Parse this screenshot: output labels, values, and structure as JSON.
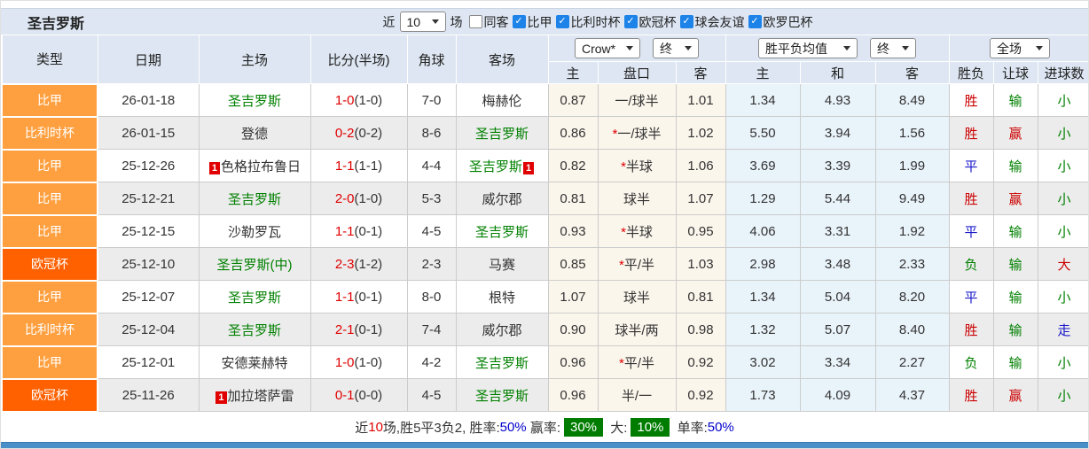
{
  "topbar": {
    "team_title": "圣吉罗斯",
    "near_label": "近",
    "matches_count": "10",
    "field_label": "场",
    "filters": [
      {
        "label": "同客",
        "checked": false
      },
      {
        "label": "比甲",
        "checked": true
      },
      {
        "label": "比利时杯",
        "checked": true
      },
      {
        "label": "欧冠杯",
        "checked": true
      },
      {
        "label": "球会友谊",
        "checked": true
      },
      {
        "label": "欧罗巴杯",
        "checked": true
      }
    ]
  },
  "table": {
    "columns": [
      "类型",
      "日期",
      "主场",
      "比分(半场)",
      "角球",
      "客场"
    ],
    "sub_columns": [
      "主",
      "盘口",
      "客",
      "主",
      "和",
      "客",
      "胜负",
      "让球",
      "进球数"
    ],
    "selects": {
      "bookmaker": "Crow*",
      "bookmaker_state": "终",
      "avg": "胜平负均值",
      "avg_state": "终",
      "scope": "全场"
    }
  },
  "colors": {
    "league_orange": "#ffa040",
    "league_red": "#ff6000",
    "red": "#cc0000",
    "blue": "#1717c9",
    "green": "#008000"
  },
  "result_color_map": {
    "胜": "red",
    "平": "blue",
    "负": "green",
    "赢": "red",
    "输": "green",
    "走": "blue",
    "大": "red",
    "小": "green"
  },
  "rows": [
    {
      "league": "比甲",
      "league_color": "orange",
      "date": "26-01-18",
      "home": {
        "name": "圣吉罗斯",
        "green": true
      },
      "score_ft": "1-0",
      "score_ht": "(1-0)",
      "corner": "7-0",
      "away": {
        "name": "梅赫伦",
        "green": false
      },
      "odds_home": "0.87",
      "handicap": "一/球半",
      "handicap_star": false,
      "odds_away": "1.01",
      "avg_home": "1.34",
      "avg_draw": "4.93",
      "avg_away": "8.49",
      "res_wdl": "胜",
      "res_handicap": "输",
      "res_goals": "小"
    },
    {
      "league": "比利时杯",
      "league_color": "orange",
      "date": "26-01-15",
      "home": {
        "name": "登德",
        "green": false
      },
      "score_ft": "0-2",
      "score_ht": "(0-2)",
      "corner": "8-6",
      "away": {
        "name": "圣吉罗斯",
        "green": true
      },
      "odds_home": "0.86",
      "handicap": "一/球半",
      "handicap_star": true,
      "odds_away": "1.02",
      "avg_home": "5.50",
      "avg_draw": "3.94",
      "avg_away": "1.56",
      "res_wdl": "胜",
      "res_handicap": "赢",
      "res_goals": "小"
    },
    {
      "league": "比甲",
      "league_color": "orange",
      "date": "25-12-26",
      "home": {
        "name": "色格拉布鲁日",
        "green": false,
        "badge_pre": "1"
      },
      "score_ft": "1-1",
      "score_ht": "(1-1)",
      "corner": "4-4",
      "away": {
        "name": "圣吉罗斯",
        "green": true,
        "badge_post": "1"
      },
      "odds_home": "0.82",
      "handicap": "半球",
      "handicap_star": true,
      "odds_away": "1.06",
      "avg_home": "3.69",
      "avg_draw": "3.39",
      "avg_away": "1.99",
      "res_wdl": "平",
      "res_handicap": "输",
      "res_goals": "小"
    },
    {
      "league": "比甲",
      "league_color": "orange",
      "date": "25-12-21",
      "home": {
        "name": "圣吉罗斯",
        "green": true
      },
      "score_ft": "2-0",
      "score_ht": "(1-0)",
      "corner": "5-3",
      "away": {
        "name": "威尔郡",
        "green": false
      },
      "odds_home": "0.81",
      "handicap": "球半",
      "handicap_star": false,
      "odds_away": "1.07",
      "avg_home": "1.29",
      "avg_draw": "5.44",
      "avg_away": "9.49",
      "res_wdl": "胜",
      "res_handicap": "赢",
      "res_goals": "小"
    },
    {
      "league": "比甲",
      "league_color": "orange",
      "date": "25-12-15",
      "home": {
        "name": "沙勒罗瓦",
        "green": false
      },
      "score_ft": "1-1",
      "score_ht": "(0-1)",
      "corner": "4-5",
      "away": {
        "name": "圣吉罗斯",
        "green": true
      },
      "odds_home": "0.93",
      "handicap": "半球",
      "handicap_star": true,
      "odds_away": "0.95",
      "avg_home": "4.06",
      "avg_draw": "3.31",
      "avg_away": "1.92",
      "res_wdl": "平",
      "res_handicap": "输",
      "res_goals": "小"
    },
    {
      "league": "欧冠杯",
      "league_color": "red",
      "date": "25-12-10",
      "home": {
        "name": "圣吉罗斯(中)",
        "green": true
      },
      "score_ft": "2-3",
      "score_ht": "(1-2)",
      "corner": "2-3",
      "away": {
        "name": "马赛",
        "green": false
      },
      "odds_home": "0.85",
      "handicap": "平/半",
      "handicap_star": true,
      "odds_away": "1.03",
      "avg_home": "2.98",
      "avg_draw": "3.48",
      "avg_away": "2.33",
      "res_wdl": "负",
      "res_handicap": "输",
      "res_goals": "大"
    },
    {
      "league": "比甲",
      "league_color": "orange",
      "date": "25-12-07",
      "home": {
        "name": "圣吉罗斯",
        "green": true
      },
      "score_ft": "1-1",
      "score_ht": "(0-1)",
      "corner": "8-0",
      "away": {
        "name": "根特",
        "green": false
      },
      "odds_home": "1.07",
      "handicap": "球半",
      "handicap_star": false,
      "odds_away": "0.81",
      "avg_home": "1.34",
      "avg_draw": "5.04",
      "avg_away": "8.20",
      "res_wdl": "平",
      "res_handicap": "输",
      "res_goals": "小"
    },
    {
      "league": "比利时杯",
      "league_color": "orange",
      "date": "25-12-04",
      "home": {
        "name": "圣吉罗斯",
        "green": true
      },
      "score_ft": "2-1",
      "score_ht": "(0-1)",
      "corner": "7-4",
      "away": {
        "name": "威尔郡",
        "green": false
      },
      "odds_home": "0.90",
      "handicap": "球半/两",
      "handicap_star": false,
      "odds_away": "0.98",
      "avg_home": "1.32",
      "avg_draw": "5.07",
      "avg_away": "8.40",
      "res_wdl": "胜",
      "res_handicap": "输",
      "res_goals": "走"
    },
    {
      "league": "比甲",
      "league_color": "orange",
      "date": "25-12-01",
      "home": {
        "name": "安德莱赫特",
        "green": false
      },
      "score_ft": "1-0",
      "score_ht": "(1-0)",
      "corner": "4-2",
      "away": {
        "name": "圣吉罗斯",
        "green": true
      },
      "odds_home": "0.96",
      "handicap": "平/半",
      "handicap_star": true,
      "odds_away": "0.92",
      "avg_home": "3.02",
      "avg_draw": "3.34",
      "avg_away": "2.27",
      "res_wdl": "负",
      "res_handicap": "输",
      "res_goals": "小"
    },
    {
      "league": "欧冠杯",
      "league_color": "red",
      "date": "25-11-26",
      "home": {
        "name": "加拉塔萨雷",
        "green": false,
        "badge_pre": "1"
      },
      "score_ft": "0-1",
      "score_ht": "(0-0)",
      "corner": "4-5",
      "away": {
        "name": "圣吉罗斯",
        "green": true
      },
      "odds_home": "0.96",
      "handicap": "半/一",
      "handicap_star": false,
      "odds_away": "0.92",
      "avg_home": "1.73",
      "avg_draw": "4.09",
      "avg_away": "4.37",
      "res_wdl": "胜",
      "res_handicap": "赢",
      "res_goals": "小"
    }
  ],
  "footer": {
    "near": "近",
    "count": "10",
    "summary": "场,胜5平3负2, 胜率:",
    "win_rate": "50%",
    "win_label": " 赢率:",
    "win_box": "30%",
    "big_label": " 大:",
    "big_box": "10%",
    "single_label": " 单率:",
    "single_rate": "50%"
  }
}
